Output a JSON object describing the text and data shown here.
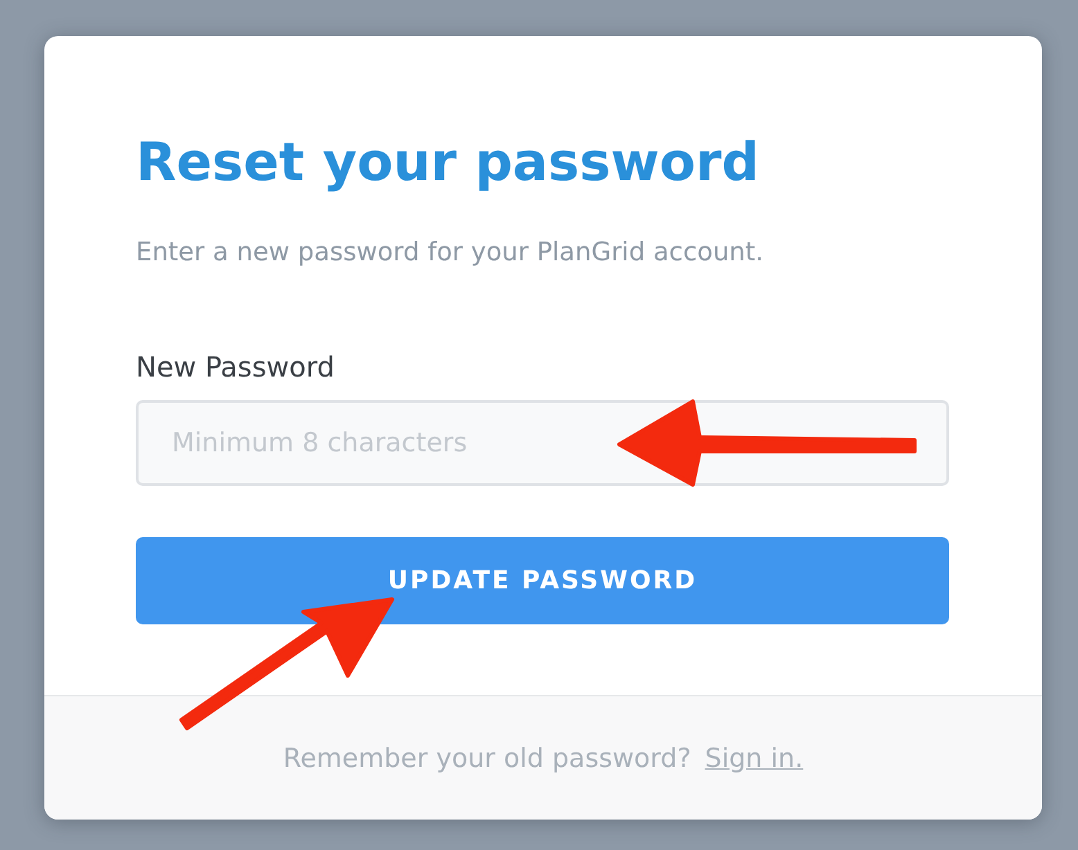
{
  "dialog": {
    "title": "Reset your password",
    "subtitle": "Enter a new password for your PlanGrid account.",
    "field": {
      "label": "New Password",
      "placeholder": "Minimum 8 characters"
    },
    "button": "UPDATE PASSWORD",
    "footer": {
      "text": "Remember your old password?",
      "link": "Sign in."
    }
  }
}
